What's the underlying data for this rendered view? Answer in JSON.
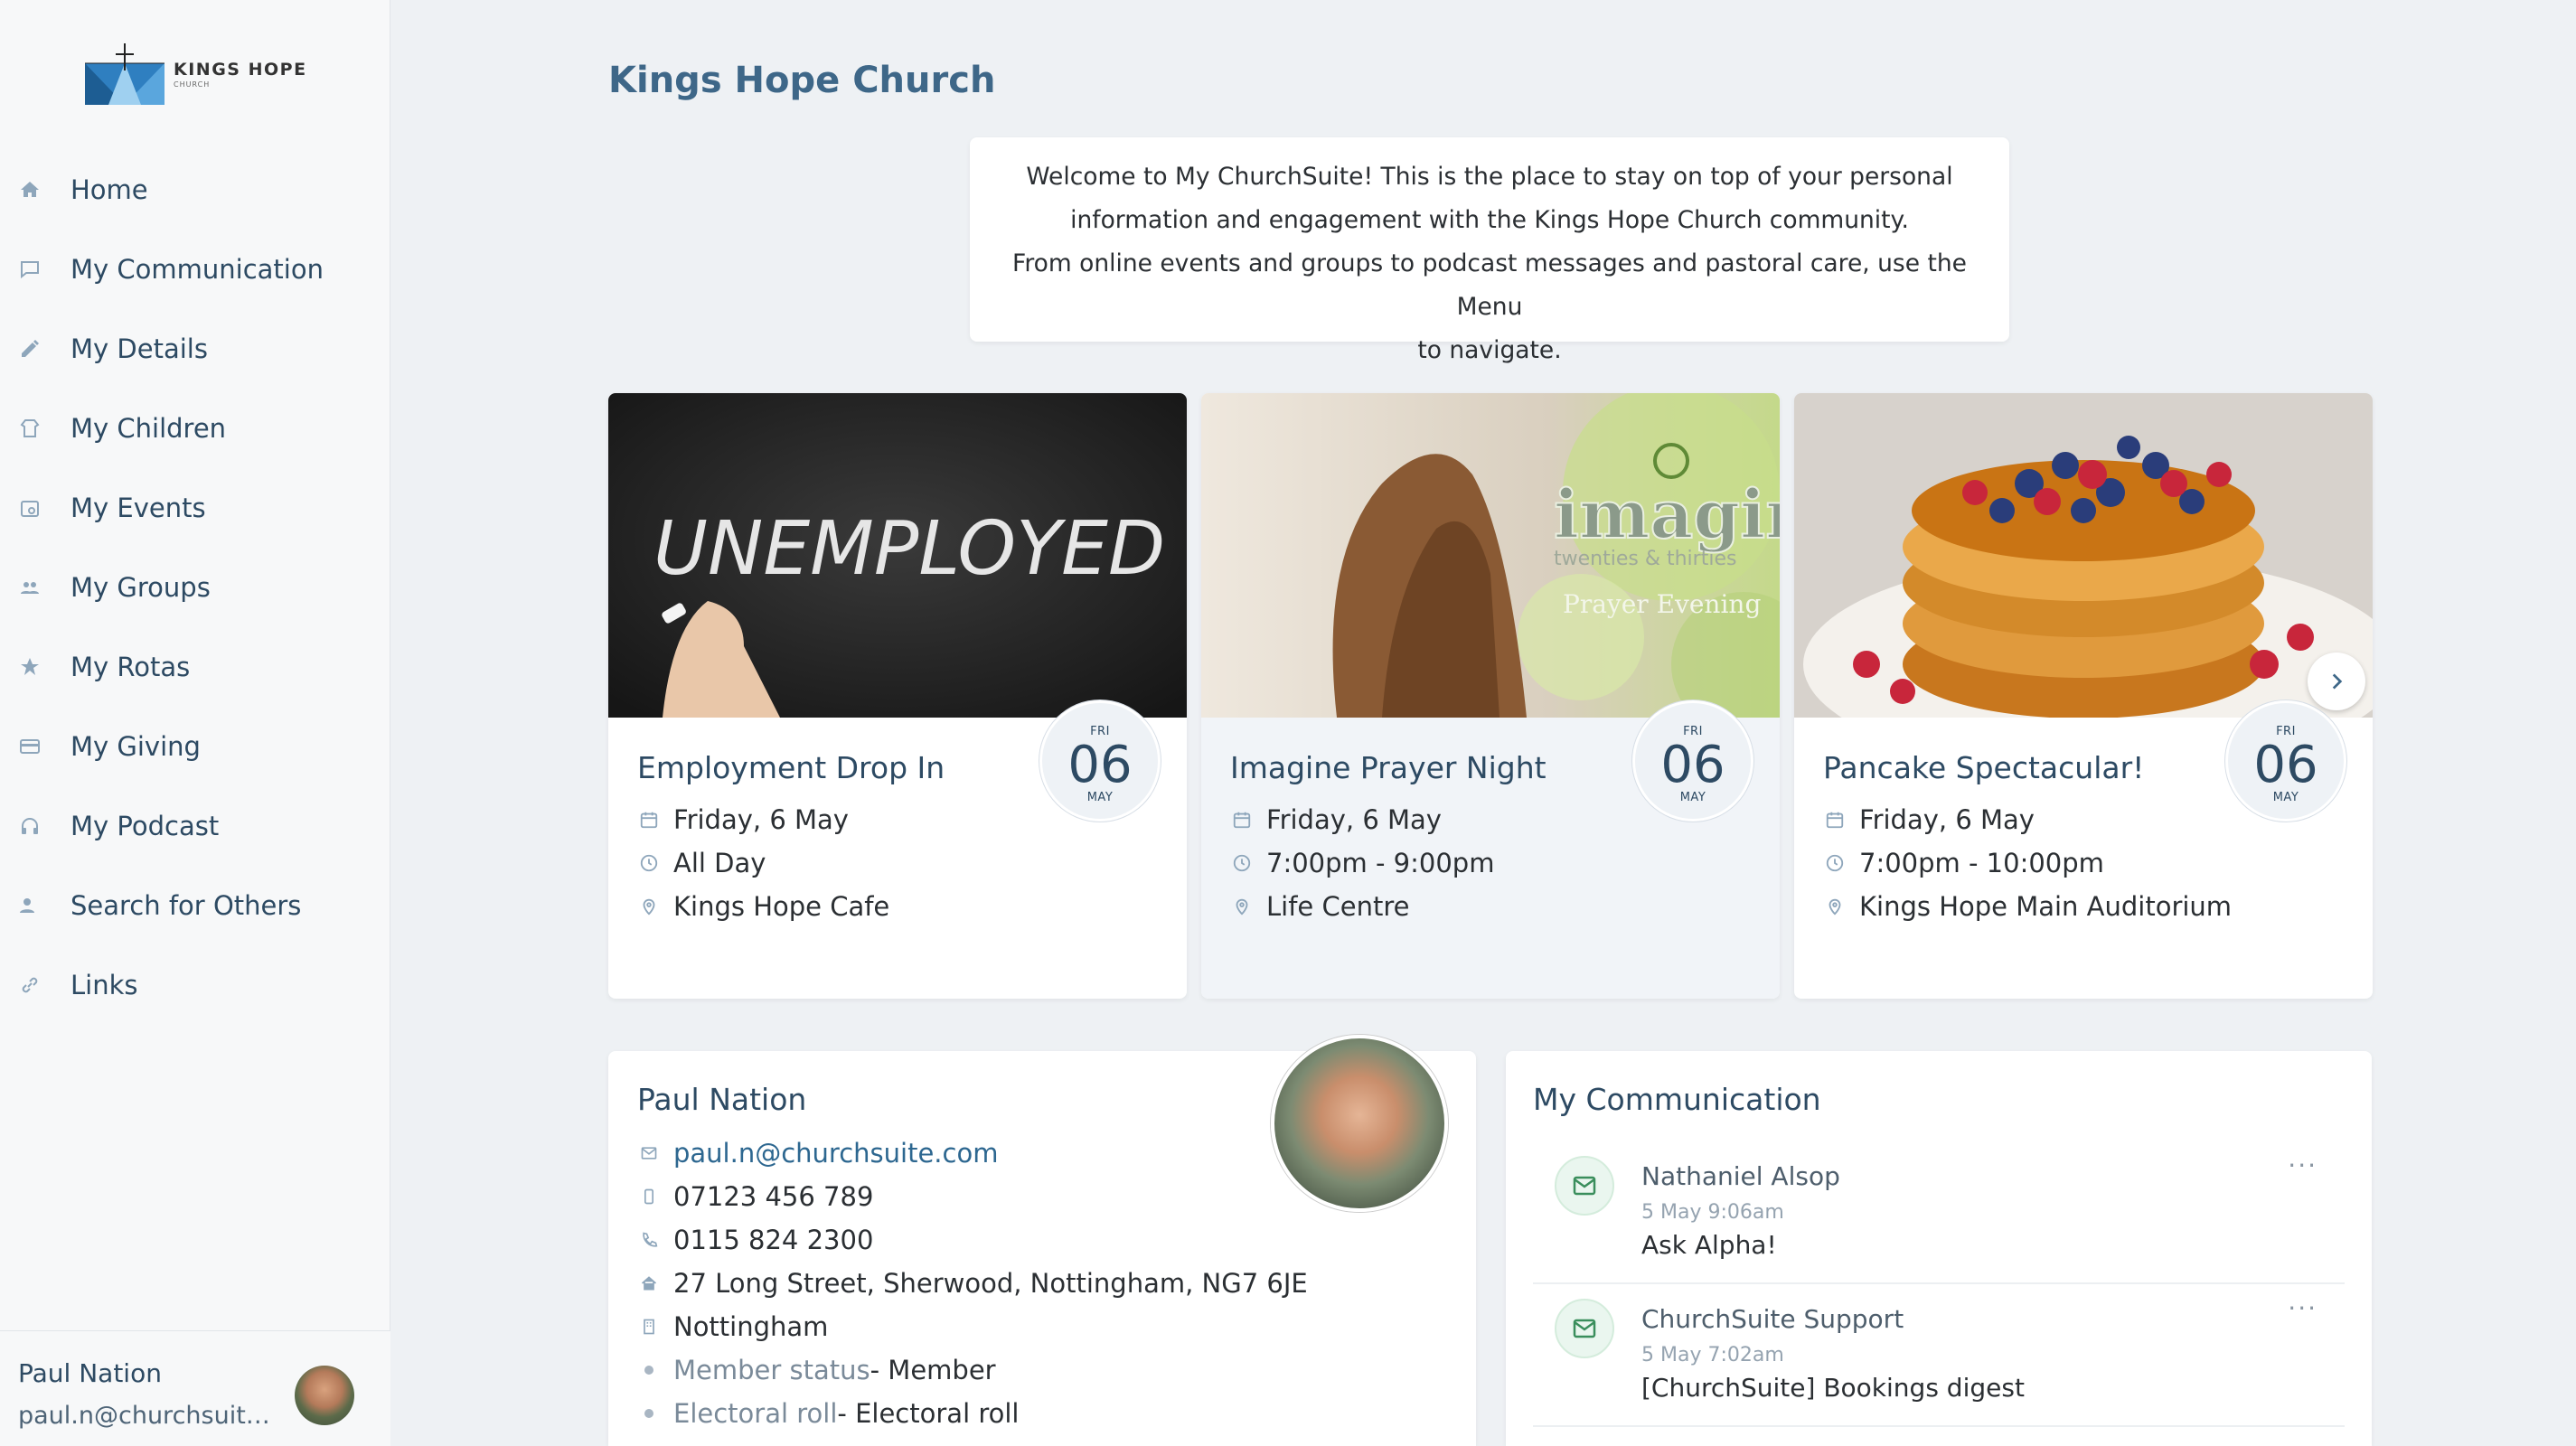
{
  "app": {
    "logo_text": "KINGS HOPE",
    "logo_sub": "CHURCH",
    "page_title": "Kings Hope Church"
  },
  "sidebar": {
    "items": [
      {
        "label": "Home",
        "icon": "home-icon"
      },
      {
        "label": "My Communication",
        "icon": "chat-icon"
      },
      {
        "label": "My Details",
        "icon": "pencil-icon"
      },
      {
        "label": "My Children",
        "icon": "child-icon"
      },
      {
        "label": "My Events",
        "icon": "calendar-icon"
      },
      {
        "label": "My Groups",
        "icon": "people-icon"
      },
      {
        "label": "My Rotas",
        "icon": "star-icon"
      },
      {
        "label": "My Giving",
        "icon": "credit-card-icon"
      },
      {
        "label": "My Podcast",
        "icon": "headphones-icon"
      },
      {
        "label": "Search for Others",
        "icon": "person-search-icon"
      },
      {
        "label": "Links",
        "icon": "link-icon"
      }
    ],
    "user": {
      "name": "Paul Nation",
      "email": "paul.n@churchsuite.com"
    }
  },
  "welcome": {
    "line1": "Welcome to My ChurchSuite! This is the place to stay on top of your personal",
    "line2": "information and engagement with the Kings Hope Church community.",
    "line3": "From online events and groups to podcast messages and pastoral care, use the Menu",
    "line4": "to navigate."
  },
  "events": [
    {
      "title": "Employment Drop In",
      "date": "Friday, 6 May",
      "time": "All Day",
      "location": "Kings Hope Cafe",
      "badge": {
        "dow": "FRI",
        "day": "06",
        "month": "MAY"
      },
      "image_text": "UNEMPLOYED"
    },
    {
      "title": "Imagine Prayer Night",
      "date": "Friday, 6 May",
      "time": "7:00pm - 9:00pm",
      "location": "Life Centre",
      "badge": {
        "dow": "FRI",
        "day": "06",
        "month": "MAY"
      },
      "image_text": "imagine",
      "image_sub": "twenties & thirties",
      "image_caption": "Prayer Evening"
    },
    {
      "title": "Pancake Spectacular!",
      "date": "Friday, 6 May",
      "time": "7:00pm - 10:00pm",
      "location": "Kings Hope Main Auditorium",
      "badge": {
        "dow": "FRI",
        "day": "06",
        "month": "MAY"
      }
    }
  ],
  "profile": {
    "name": "Paul Nation",
    "email": "paul.n@churchsuite.com",
    "mobile": "07123 456 789",
    "phone": "0115 824 2300",
    "address": "27 Long Street, Sherwood, Nottingham, NG7 6JE",
    "site": "Nottingham",
    "member_status_label": "Member status",
    "member_status_value": " - Member",
    "electoral_label": "Electoral roll",
    "electoral_value": " - Electoral roll"
  },
  "communication": {
    "title": "My Communication",
    "messages": [
      {
        "from": "Nathaniel Alsop",
        "time": "5 May 9:06am",
        "subject": "Ask Alpha!",
        "more": "···"
      },
      {
        "from": "ChurchSuite Support",
        "time": "5 May 7:02am",
        "subject": "[ChurchSuite] Bookings digest",
        "more": "···"
      }
    ]
  },
  "colors": {
    "accent": "#3e6788",
    "nav_text": "#2d4a63",
    "icon": "#8ea6bb",
    "background": "#eef1f4",
    "message_icon": "#3a8e5c"
  }
}
